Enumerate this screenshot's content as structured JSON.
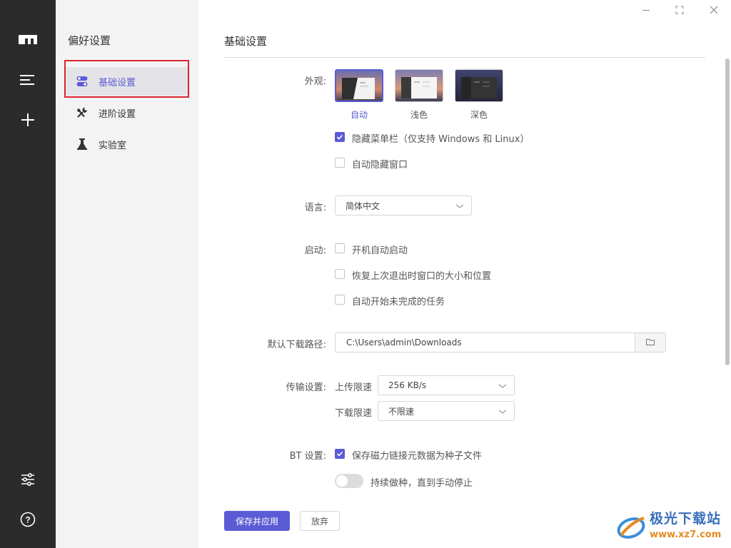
{
  "app": {
    "brand_icon": "motrix-logo-icon"
  },
  "rail": {
    "items": [
      {
        "icon": "menu-icon"
      },
      {
        "icon": "add-icon"
      },
      {
        "icon": "preferences-sliders-icon"
      },
      {
        "icon": "help-icon"
      }
    ]
  },
  "subnav": {
    "title": "偏好设置",
    "items": [
      {
        "label": "基础设置",
        "icon": "toggle-settings-icon",
        "active": true
      },
      {
        "label": "进阶设置",
        "icon": "tools-icon",
        "active": false
      },
      {
        "label": "实验室",
        "icon": "flask-icon",
        "active": false
      }
    ]
  },
  "window": {
    "controls": [
      "minimize-icon",
      "maximize-icon",
      "close-icon"
    ]
  },
  "main": {
    "title": "基础设置",
    "appearance": {
      "label": "外观:",
      "themes": [
        {
          "caption": "自动",
          "selected": true
        },
        {
          "caption": "浅色",
          "selected": false
        },
        {
          "caption": "深色",
          "selected": false
        }
      ],
      "hide_menubar": {
        "label": "隐藏菜单栏（仅支持 Windows 和 Linux）",
        "checked": true
      },
      "auto_hide_window": {
        "label": "自动隐藏窗口",
        "checked": false
      }
    },
    "language": {
      "label": "语言:",
      "value": "简体中文"
    },
    "startup": {
      "label": "启动:",
      "options": [
        {
          "label": "开机自动启动",
          "checked": false
        },
        {
          "label": "恢复上次退出时窗口的大小和位置",
          "checked": false
        },
        {
          "label": "自动开始未完成的任务",
          "checked": false
        }
      ]
    },
    "download_path": {
      "label": "默认下载路径:",
      "value": "C:\\Users\\admin\\Downloads"
    },
    "transfer": {
      "label": "传输设置:",
      "upload_label": "上传限速",
      "upload_value": "256 KB/s",
      "download_label": "下载限速",
      "download_value": "不限速"
    },
    "bt": {
      "label": "BT 设置:",
      "save_magnet": {
        "label": "保存磁力链接元数据为种子文件",
        "checked": true
      },
      "keep_seeding": {
        "label": "持续做种，直到手动停止",
        "on": false
      }
    },
    "actions": {
      "save_label": "保存并应用",
      "discard_label": "放弃"
    }
  },
  "watermark": {
    "line1": "极光下载站",
    "line2": "www.xz7.com"
  },
  "colors": {
    "accent": "#5b5bd6",
    "rail_bg": "#2b2b2b",
    "sidebar_bg": "#f3f3f4",
    "highlight": "#d9262e"
  }
}
